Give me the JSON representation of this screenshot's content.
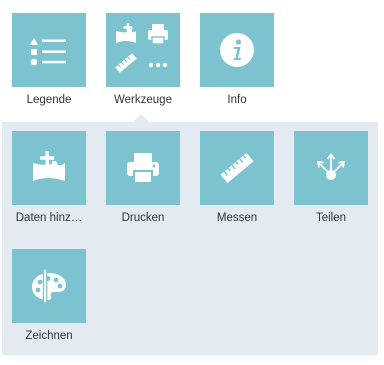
{
  "top_tools": [
    {
      "label": "Legende",
      "icon": "legend-list-icon"
    },
    {
      "label": "Werkzeuge",
      "icon": "tools-grid-icon"
    },
    {
      "label": "Info",
      "icon": "info-icon"
    }
  ],
  "tools_panel": {
    "items": [
      {
        "label": "Daten hinz…",
        "icon": "add-data-icon"
      },
      {
        "label": "Drucken",
        "icon": "printer-icon"
      },
      {
        "label": "Messen",
        "icon": "ruler-icon"
      },
      {
        "label": "Teilen",
        "icon": "share-icon"
      },
      {
        "label": "Zeichnen",
        "icon": "palette-icon"
      }
    ]
  },
  "colors": {
    "tile": "#7dc3cf",
    "panel": "#e3eaf2",
    "icon": "#ffffff"
  }
}
